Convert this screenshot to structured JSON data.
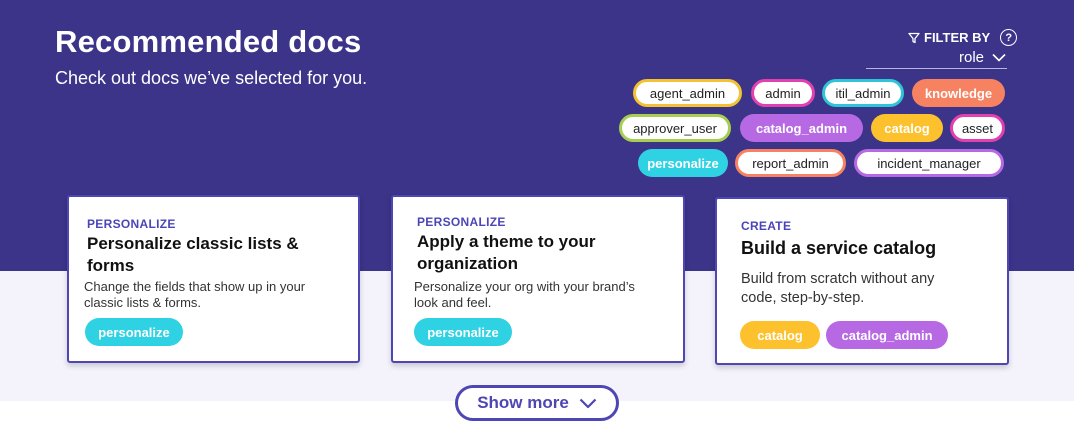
{
  "header": {
    "title": "Recommended docs",
    "subtitle": "Check out docs we’ve selected for you."
  },
  "filter": {
    "label": "FILTER BY",
    "help": "?",
    "selected": "role"
  },
  "tags": [
    {
      "label": "agent_admin",
      "style": "outline",
      "color": "#f2c230"
    },
    {
      "label": "admin",
      "style": "outline",
      "color": "#e23fb0"
    },
    {
      "label": "itil_admin",
      "style": "outline",
      "color": "#2ec5d6"
    },
    {
      "label": "knowledge",
      "style": "filled",
      "color": "#f78262"
    },
    {
      "label": "approver_user",
      "style": "outline",
      "color": "#a7cf4f"
    },
    {
      "label": "catalog_admin",
      "style": "filled",
      "color": "#b769e4"
    },
    {
      "label": "catalog",
      "style": "filled",
      "color": "#fcc12c"
    },
    {
      "label": "asset",
      "style": "outline",
      "color": "#e23fb0"
    },
    {
      "label": "personalize",
      "style": "filled",
      "color": "#2ed2e2"
    },
    {
      "label": "report_admin",
      "style": "outline",
      "color": "#f78262"
    },
    {
      "label": "incident_manager",
      "style": "outline",
      "color": "#b769e4"
    }
  ],
  "cards": [
    {
      "category": "PERSONALIZE",
      "title_line1": "Personalize classic lists &",
      "title_line2": "forms",
      "desc_line1": "Change the fields that show up in your",
      "desc_line2": "classic lists & forms.",
      "tags": [
        {
          "label": "personalize",
          "color": "#2ed2e2"
        }
      ]
    },
    {
      "category": "PERSONALIZE",
      "title_line1": "Apply a theme to your",
      "title_line2": "organization",
      "desc_line1": "Personalize your org with your brand’s",
      "desc_line2": "look and feel.",
      "tags": [
        {
          "label": "personalize",
          "color": "#2ed2e2"
        }
      ]
    },
    {
      "category": "CREATE",
      "title_line1": "Build a service catalog",
      "title_line2": "",
      "desc_line1": "Build from scratch without any",
      "desc_line2": "code, step-by-step.",
      "tags": [
        {
          "label": "catalog",
          "color": "#fcc12c"
        },
        {
          "label": "catalog_admin",
          "color": "#b769e4"
        }
      ]
    }
  ],
  "show_more": {
    "label": "Show more",
    "icon": "chevron-down-icon"
  },
  "colors": {
    "hero": "#3c3489",
    "accent": "#4d46b3"
  }
}
